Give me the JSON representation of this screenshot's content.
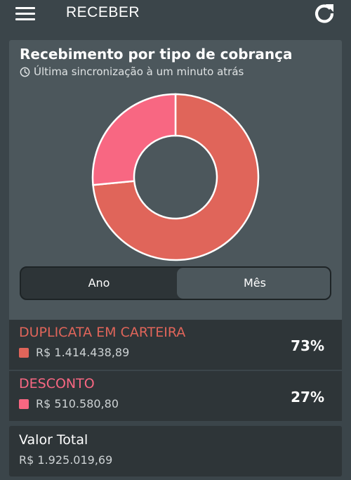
{
  "header": {
    "title": "RECEBER",
    "menu_icon": "hamburger-menu-icon",
    "refresh_icon": "refresh-icon"
  },
  "card": {
    "title": "Recebimento por tipo de cobrança",
    "sync_text": "Última sincronização à um minuto atrás"
  },
  "toggle": {
    "options": [
      "Ano",
      "Mês"
    ],
    "selected": "Mês"
  },
  "colors": {
    "duplicata": "#e0655a",
    "desconto": "#f86782"
  },
  "chart_data": {
    "type": "pie",
    "categories": [
      "DUPLICATA EM CARTEIRA",
      "DESCONTO"
    ],
    "values": [
      1414438.89,
      510580.8
    ],
    "percentages": [
      73,
      27
    ]
  },
  "items": [
    {
      "label": "DUPLICATA EM CARTEIRA",
      "value": "R$ 1.414.438,89",
      "percent": "73%"
    },
    {
      "label": "DESCONTO",
      "value": "R$ 510.580,80",
      "percent": "27%"
    }
  ],
  "total": {
    "label": "Valor Total",
    "value": "R$ 1.925.019,69"
  }
}
